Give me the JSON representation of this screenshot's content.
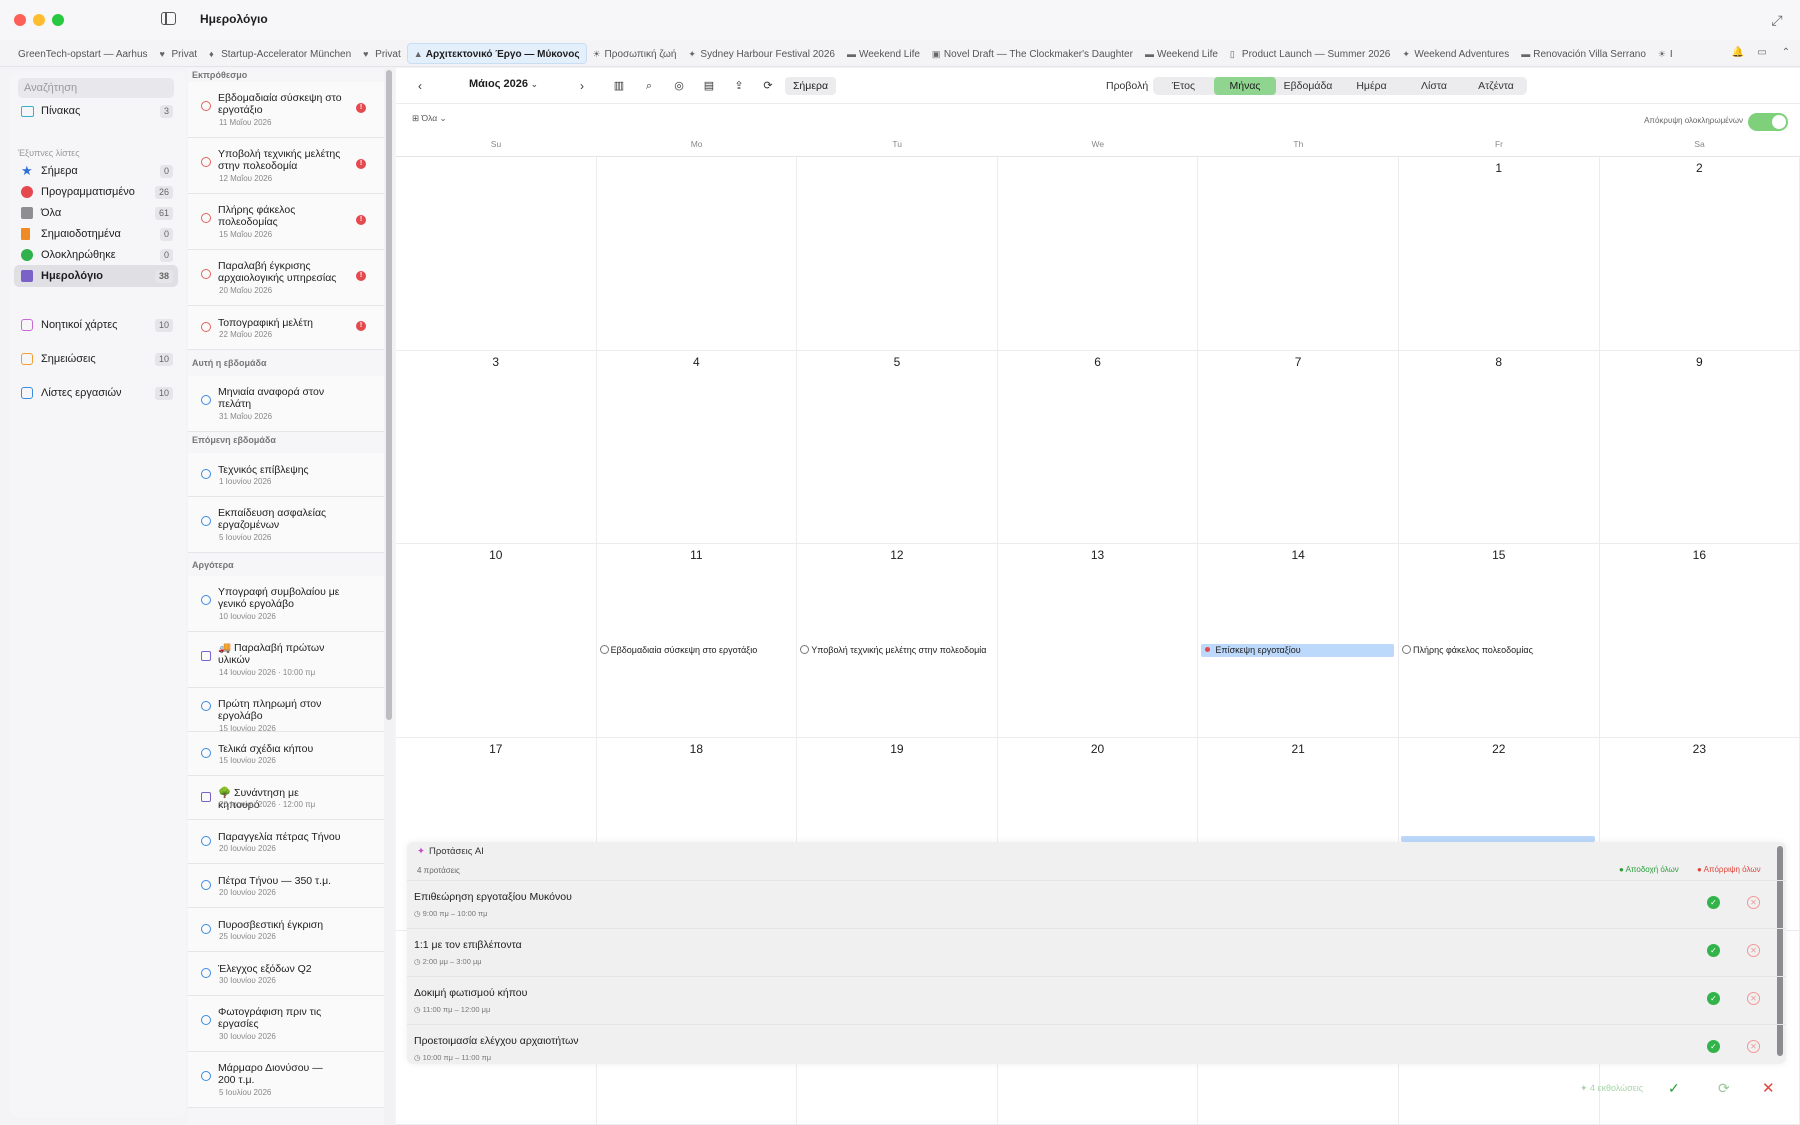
{
  "window": {
    "title": "Ημερολόγιο"
  },
  "tabs": [
    {
      "icon": "",
      "label": "GreenTech-opstart — Aarhus"
    },
    {
      "icon": "♥",
      "label": "Privat"
    },
    {
      "icon": "♦",
      "label": "Startup-Accelerator München"
    },
    {
      "icon": "♥",
      "label": "Privat"
    },
    {
      "icon": "▲",
      "label": "Αρχιτεκτονικό Έργο — Μύκονος",
      "active": true
    },
    {
      "icon": "☀",
      "label": "Προσωπική ζωή"
    },
    {
      "icon": "✦",
      "label": "Sydney Harbour Festival 2026"
    },
    {
      "icon": "▬",
      "label": "Weekend Life"
    },
    {
      "icon": "▣",
      "label": "Novel Draft — The Clockmaker's Daughter"
    },
    {
      "icon": "▬",
      "label": "Weekend Life"
    },
    {
      "icon": "▯",
      "label": "Product Launch — Summer 2026"
    },
    {
      "icon": "✦",
      "label": "Weekend Adventures"
    },
    {
      "icon": "▬",
      "label": "Renovación Villa Serrano"
    },
    {
      "icon": "☀",
      "label": "I"
    }
  ],
  "sidebar": {
    "search_placeholder": "Αναζήτηση",
    "top_item": {
      "label": "Πίνακας",
      "count": "3",
      "color": "#3ab0c8"
    },
    "section_label": "Έξυπνες λίστες",
    "smart_lists": [
      {
        "label": "Σήμερα",
        "count": "0",
        "color": "#2f6fd6",
        "icon": "star-icon"
      },
      {
        "label": "Προγραμματισμένο",
        "count": "26",
        "color": "#e5484d",
        "icon": "calendar-clock-icon"
      },
      {
        "label": "Όλα",
        "count": "61",
        "color": "#8e8e93",
        "icon": "tray-icon"
      },
      {
        "label": "Σημαιοδοτημένα",
        "count": "0",
        "color": "#f08a24",
        "icon": "flag-icon"
      },
      {
        "label": "Ολοκληρώθηκε",
        "count": "0",
        "color": "#2fb14b",
        "icon": "check-circle-icon"
      },
      {
        "label": "Ημερολόγιο",
        "count": "38",
        "color": "#7b62c8",
        "icon": "calendar-icon",
        "selected": true
      }
    ],
    "other_items": [
      {
        "label": "Νοητικοί χάρτες",
        "count": "10",
        "color": "#c86ad6",
        "icon": "mindmap-icon"
      },
      {
        "label": "Σημειώσεις",
        "count": "10",
        "color": "#f0a030",
        "icon": "notes-icon"
      },
      {
        "label": "Λίστες εργασιών",
        "count": "10",
        "color": "#3b8ce0",
        "icon": "checklist-icon"
      }
    ]
  },
  "tasklist": {
    "groups": [
      {
        "label": "Εκπρόθεσμο"
      },
      {
        "label": "Αυτή η εβδομάδα"
      },
      {
        "label": "Επόμενη εβδομάδα"
      },
      {
        "label": "Αργότερα"
      }
    ],
    "tasks": [
      {
        "title": "Εβδομαδιαία σύσκεψη στο εργοτάξιο",
        "date": "11 Μαΐου 2026",
        "flag": "!"
      },
      {
        "title": "Υποβολή τεχνικής μελέτης στην πολεοδομία",
        "date": "12 Μαΐου 2026",
        "flag": "!"
      },
      {
        "title": "Πλήρης φάκελος πολεοδομίας",
        "date": "15 Μαΐου 2026",
        "flag": "!"
      },
      {
        "title": "Παραλαβή έγκρισης αρχαιολογικής υπηρεσίας",
        "date": "20 Μαΐου 2026",
        "flag": "!"
      },
      {
        "title": "Τοπογραφική μελέτη",
        "date": "22 Μαΐου 2026",
        "flag": "!"
      },
      {
        "title": "Μηνιαία αναφορά στον πελάτη",
        "date": "31 Μαΐου 2026"
      },
      {
        "title": "Τεχνικός επίβλεψης",
        "date": "1 Ιουνίου 2026"
      },
      {
        "title": "Εκπαίδευση ασφαλείας εργαζομένων",
        "date": "5 Ιουνίου 2026"
      },
      {
        "title": "Υπογραφή συμβολαίου με γενικό εργολάβο",
        "date": "10 Ιουνίου 2026"
      },
      {
        "title": "🚚 Παραλαβή πρώτων υλικών",
        "date": "14 Ιουνίου 2026 · 10:00 πμ"
      },
      {
        "title": "Πρώτη πληρωμή στον εργολάβο",
        "date": "15 Ιουνίου 2026"
      },
      {
        "title": "Τελικά σχέδια κήπου",
        "date": "15 Ιουνίου 2026"
      },
      {
        "title": "🌳 Συνάντηση με κηπουρό",
        "date": "20 Ιουνίου 2026 · 12:00 πμ"
      },
      {
        "title": "Παραγγελία πέτρας Τήνου",
        "date": "20 Ιουνίου 2026"
      },
      {
        "title": "Πέτρα Τήνου — 350 τ.μ.",
        "date": "20 Ιουνίου 2026"
      },
      {
        "title": "Πυροσβεστική έγκριση",
        "date": "25 Ιουνίου 2026"
      },
      {
        "title": "Έλεγχος εξόδων Q2",
        "date": "30 Ιουνίου 2026"
      },
      {
        "title": "Φωτογράφιση πριν τις εργασίες",
        "date": "30 Ιουνίου 2026"
      },
      {
        "title": "Μάρμαρο Διονύσου — 200 τ.μ.",
        "date": "5 Ιουλίου 2026"
      }
    ]
  },
  "toolbar": {
    "prev": "‹",
    "next": "›",
    "month": "Μάιος 2026",
    "today": "Σήμερα",
    "view_label": "Προβολή",
    "views": [
      "Έτος",
      "Μήνας",
      "Εβδομάδα",
      "Ημέρα",
      "Λίστα",
      "Ατζέντα"
    ],
    "active_view": "Μήνας",
    "filter": "Όλα",
    "hide_completed": "Απόκρυψη ολοκληρωμένων"
  },
  "calendar": {
    "weekdays": [
      "Su",
      "Mo",
      "Tu",
      "We",
      "Th",
      "Fr",
      "Sa"
    ],
    "weeks": [
      [
        "",
        "",
        "",
        "",
        "",
        "1",
        "2"
      ],
      [
        "3",
        "4",
        "5",
        "6",
        "7",
        "8",
        "9"
      ],
      [
        "10",
        "11",
        "12",
        "13",
        "14",
        "15",
        "16"
      ],
      [
        "17",
        "18",
        "19",
        "20",
        "21",
        "22",
        "23"
      ],
      [
        "",
        "",
        "",
        "",
        "",
        "",
        ""
      ]
    ],
    "events": [
      {
        "week": 2,
        "day": 1,
        "title": "Εβδομαδιαία σύσκεψη στο εργοτάξιο",
        "style": "task"
      },
      {
        "week": 2,
        "day": 2,
        "title": "Υποβολή τεχνικής μελέτης στην πολεοδομία",
        "style": "task"
      },
      {
        "week": 2,
        "day": 4,
        "title": "Επίσκεψη εργοταξίου",
        "style": "event"
      },
      {
        "week": 2,
        "day": 5,
        "title": "Πλήρης φάκελος πολεοδομίας",
        "style": "task"
      }
    ]
  },
  "ai_panel": {
    "title": "Προτάσεις AI",
    "count": "4 προτάσεις",
    "accept_all": "Αποδοχή όλων",
    "reject_all": "Απόρριψη όλων",
    "suggestions": [
      {
        "name": "Επιθεώρηση εργοταξίου Μυκόνου",
        "time": "9:00 πμ – 10:00 πμ"
      },
      {
        "name": "1:1 με τον επιβλέποντα",
        "time": "2:00 μμ – 3:00 μμ"
      },
      {
        "name": "Δοκιμή φωτισμού κήπου",
        "time": "11:00 πμ – 12:00 μμ"
      },
      {
        "name": "Προετοιμασία ελέγχου αρχαιοτήτων",
        "time": "10:00 πμ – 11:00 πμ"
      }
    ],
    "footer": "4 εκθολώσεις"
  },
  "colors": {
    "accent": "#8fd48f",
    "event_blue": "#bcd8fa",
    "overdue": "#e5484d"
  }
}
